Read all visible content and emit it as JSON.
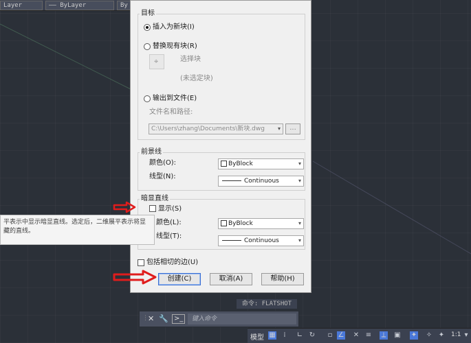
{
  "cad": {
    "layer_combo_1": "Layer",
    "layer_combo_2": "—— ByLayer",
    "layer_combo_3": "By"
  },
  "dialog": {
    "target_group": {
      "title": "目标",
      "insert_new_block": "插入为新块(I)",
      "replace_existing_block": "替换现有块(R)",
      "select_block": "选择块",
      "no_block_selected": "(未选定块)",
      "export_to_file": "输出到文件(E)",
      "filename_path_label": "文件名和路径:",
      "filename_path_value": "C:\\Users\\zhang\\Documents\\新块.dwg",
      "browse_button": "..."
    },
    "foreground_group": {
      "title": "前景线",
      "color_label": "颜色(O):",
      "color_value": "ByBlock",
      "linetype_label": "线型(N):",
      "linetype_value": "Continuous"
    },
    "obscured_group": {
      "title": "暗显直线",
      "show_label": "显示(S)",
      "color_label": "颜色(L):",
      "color_value": "ByBlock",
      "linetype_label": "线型(T):",
      "linetype_value": "Continuous"
    },
    "include_tangent_edges": "包括相切的边(U)",
    "buttons": {
      "create": "创建(C)",
      "cancel": "取消(A)",
      "help": "帮助(H)"
    }
  },
  "tooltip": {
    "line1": "平表示中显示暗显直线。选定后，二维展平表示将显",
    "line2": "藏的直线。"
  },
  "command": {
    "recent": "命令: FLATSHOT",
    "placeholder": "键入命令"
  },
  "status": {
    "model_tab": "模型",
    "scale": "1:1"
  },
  "colors": {
    "accent": "#3a6ed3",
    "arrow": "#e01c1c"
  }
}
